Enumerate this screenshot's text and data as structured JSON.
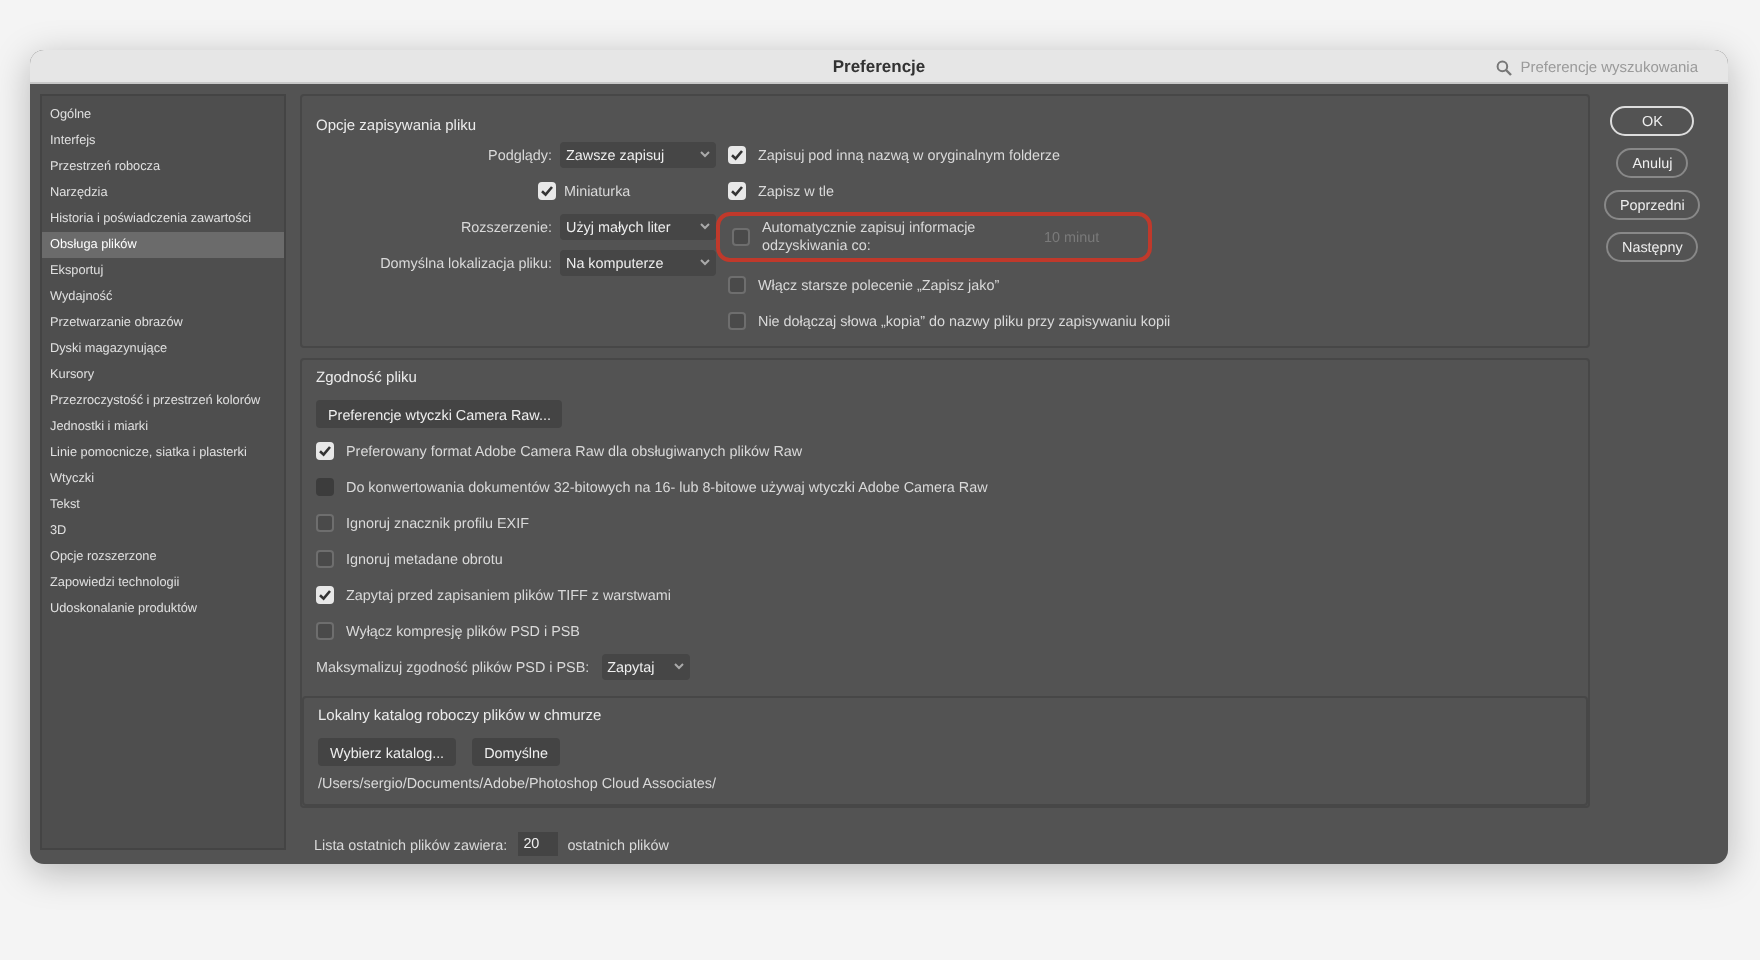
{
  "window": {
    "title": "Preferencje",
    "search_placeholder": "Preferencje wyszukowania"
  },
  "sidebar": {
    "items": [
      {
        "label": "Ogólne",
        "selected": false
      },
      {
        "label": "Interfejs",
        "selected": false
      },
      {
        "label": "Przestrzeń robocza",
        "selected": false
      },
      {
        "label": "Narzędzia",
        "selected": false
      },
      {
        "label": "Historia i poświadczenia zawartości",
        "selected": false
      },
      {
        "label": "Obsługa plików",
        "selected": true
      },
      {
        "label": "Eksportuj",
        "selected": false
      },
      {
        "label": "Wydajność",
        "selected": false
      },
      {
        "label": "Przetwarzanie obrazów",
        "selected": false
      },
      {
        "label": "Dyski magazynujące",
        "selected": false
      },
      {
        "label": "Kursory",
        "selected": false
      },
      {
        "label": "Przezroczystość i przestrzeń kolorów",
        "selected": false
      },
      {
        "label": "Jednostki i miarki",
        "selected": false
      },
      {
        "label": "Linie pomocnicze, siatka i plasterki",
        "selected": false
      },
      {
        "label": "Wtyczki",
        "selected": false
      },
      {
        "label": "Tekst",
        "selected": false
      },
      {
        "label": "3D",
        "selected": false
      },
      {
        "label": "Opcje rozszerzone",
        "selected": false
      },
      {
        "label": "Zapowiedzi technologii",
        "selected": false
      },
      {
        "label": "Udoskonalanie produktów",
        "selected": false
      }
    ]
  },
  "save_options": {
    "title": "Opcje zapisywania pliku",
    "fields": [
      {
        "kind": "select",
        "label": "Podglądy:",
        "value": "Zawsze zapisuj"
      },
      {
        "kind": "checkbox",
        "label": "Miniaturka",
        "checked": true
      },
      {
        "kind": "select",
        "label": "Rozszerzenie:",
        "value": "Użyj małych liter"
      },
      {
        "kind": "select",
        "label": "Domyślna lokalizacja pliku:",
        "value": "Na komputerze"
      }
    ],
    "options": [
      {
        "label": "Zapisuj pod inną nazwą w oryginalnym folderze",
        "checked": true,
        "highlighted": false
      },
      {
        "label": "Zapisz w tle",
        "checked": true,
        "highlighted": false
      },
      {
        "label": "Automatycznie zapisuj informacje odzyskiwania co:",
        "checked": false,
        "highlighted": true,
        "interval": "10 minut"
      },
      {
        "label": "Włącz starsze polecenie „Zapisz jako”",
        "checked": false,
        "highlighted": false
      },
      {
        "label": "Nie dołączaj słowa „kopia” do nazwy pliku przy zapisywaniu kopii",
        "checked": false,
        "highlighted": false
      }
    ]
  },
  "compatibility": {
    "title": "Zgodność pliku",
    "button": "Preferencje wtyczki Camera Raw...",
    "options": [
      {
        "label": "Preferowany format Adobe Camera Raw dla obsługiwanych plików Raw",
        "checked": true,
        "disabled": false
      },
      {
        "label": "Do konwertowania dokumentów 32-bitowych na 16- lub 8-bitowe używaj wtyczki Adobe Camera Raw",
        "checked": false,
        "disabled": true
      },
      {
        "label": "Ignoruj znacznik profilu EXIF",
        "checked": false,
        "disabled": false
      },
      {
        "label": "Ignoruj metadane obrotu",
        "checked": false,
        "disabled": false
      },
      {
        "label": "Zapytaj przed zapisaniem plików TIFF z warstwami",
        "checked": true,
        "disabled": false
      },
      {
        "label": "Wyłącz kompresję plików PSD i PSB",
        "checked": false,
        "disabled": false
      }
    ],
    "maximize": {
      "label": "Maksymalizuj zgodność plików PSD i PSB:",
      "value": "Zapytaj"
    }
  },
  "cloud": {
    "title": "Lokalny katalog roboczy plików w chmurze",
    "buttons": [
      "Wybierz katalog...",
      "Domyślne"
    ],
    "path": "/Users/sergio/Documents/Adobe/Photoshop Cloud Associates/"
  },
  "recent": {
    "label": "Lista ostatnich plików zawiera:",
    "value": "20",
    "suffix": "ostatnich plików"
  },
  "buttons": [
    {
      "label": "OK",
      "default": true
    },
    {
      "label": "Anuluj",
      "default": false
    },
    {
      "label": "Poprzedni",
      "default": false
    },
    {
      "label": "Następny",
      "default": false
    }
  ]
}
